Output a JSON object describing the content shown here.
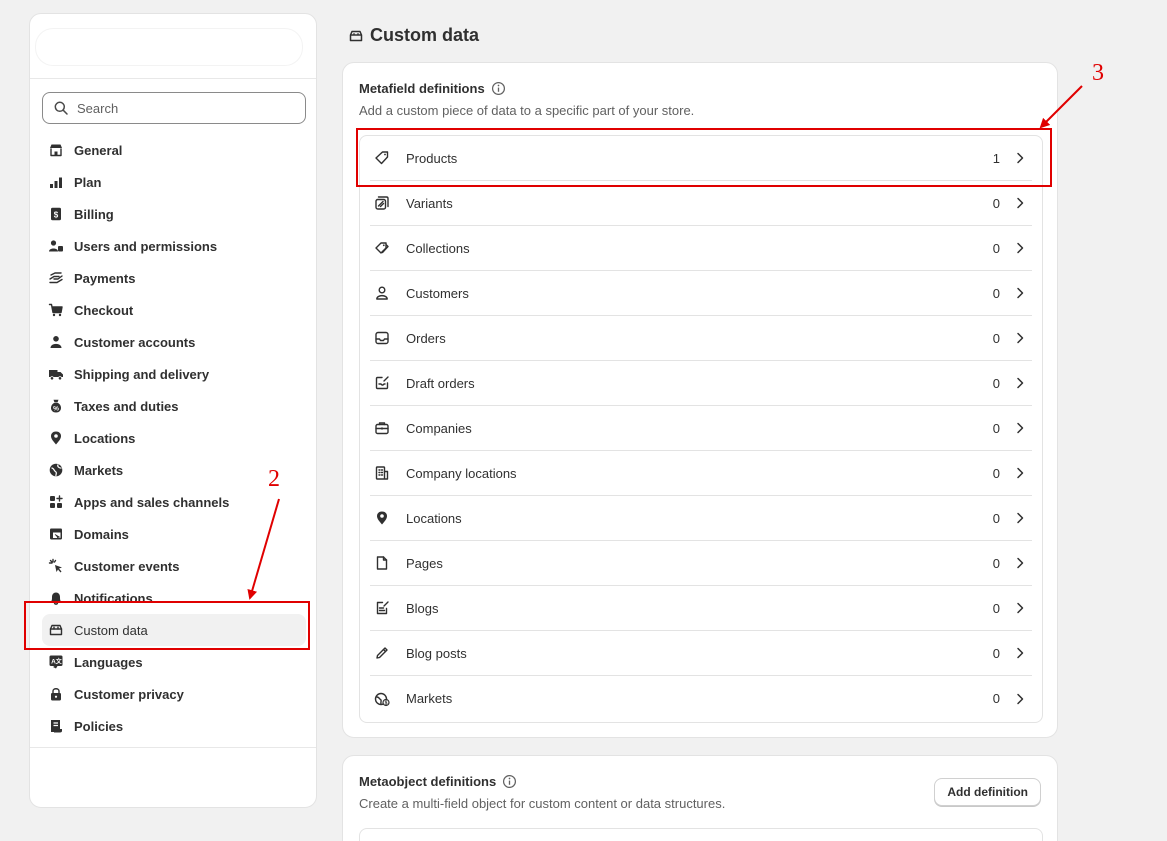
{
  "sidebar": {
    "search_placeholder": "Search",
    "items": [
      {
        "label": "General",
        "icon": "store-icon"
      },
      {
        "label": "Plan",
        "icon": "plan-chart-icon"
      },
      {
        "label": "Billing",
        "icon": "billing-icon"
      },
      {
        "label": "Users and permissions",
        "icon": "users-icon"
      },
      {
        "label": "Payments",
        "icon": "payments-icon"
      },
      {
        "label": "Checkout",
        "icon": "cart-icon"
      },
      {
        "label": "Customer accounts",
        "icon": "person-icon"
      },
      {
        "label": "Shipping and delivery",
        "icon": "truck-icon"
      },
      {
        "label": "Taxes and duties",
        "icon": "tax-bag-icon"
      },
      {
        "label": "Locations",
        "icon": "location-pin-icon"
      },
      {
        "label": "Markets",
        "icon": "globe-icon"
      },
      {
        "label": "Apps and sales channels",
        "icon": "apps-icon"
      },
      {
        "label": "Domains",
        "icon": "domains-icon"
      },
      {
        "label": "Customer events",
        "icon": "cursor-click-icon"
      },
      {
        "label": "Notifications",
        "icon": "bell-icon"
      },
      {
        "label": "Custom data",
        "icon": "custom-data-icon",
        "active": true
      },
      {
        "label": "Languages",
        "icon": "translate-icon"
      },
      {
        "label": "Customer privacy",
        "icon": "lock-icon"
      },
      {
        "label": "Policies",
        "icon": "policy-scroll-icon"
      }
    ]
  },
  "page": {
    "title": "Custom data"
  },
  "metafields": {
    "heading": "Metafield definitions",
    "subtitle": "Add a custom piece of data to a specific part of your store.",
    "rows": [
      {
        "label": "Products",
        "count": "1",
        "icon": "tag-icon"
      },
      {
        "label": "Variants",
        "count": "0",
        "icon": "variant-icon"
      },
      {
        "label": "Collections",
        "count": "0",
        "icon": "collection-tags-icon"
      },
      {
        "label": "Customers",
        "count": "0",
        "icon": "customer-icon"
      },
      {
        "label": "Orders",
        "count": "0",
        "icon": "inbox-icon"
      },
      {
        "label": "Draft orders",
        "count": "0",
        "icon": "draft-order-icon"
      },
      {
        "label": "Companies",
        "count": "0",
        "icon": "briefcase-icon"
      },
      {
        "label": "Company locations",
        "count": "0",
        "icon": "building-icon"
      },
      {
        "label": "Locations",
        "count": "0",
        "icon": "location-pin-icon"
      },
      {
        "label": "Pages",
        "count": "0",
        "icon": "page-icon"
      },
      {
        "label": "Blogs",
        "count": "0",
        "icon": "blog-icon"
      },
      {
        "label": "Blog posts",
        "count": "0",
        "icon": "pencil-icon"
      },
      {
        "label": "Markets",
        "count": "0",
        "icon": "globe-dollar-icon"
      }
    ]
  },
  "metaobjects": {
    "heading": "Metaobject definitions",
    "subtitle": "Create a multi-field object for custom content or data structures.",
    "add_button": "Add definition"
  },
  "annotations": {
    "step2": "2",
    "step3": "3",
    "color": "#e00000"
  }
}
